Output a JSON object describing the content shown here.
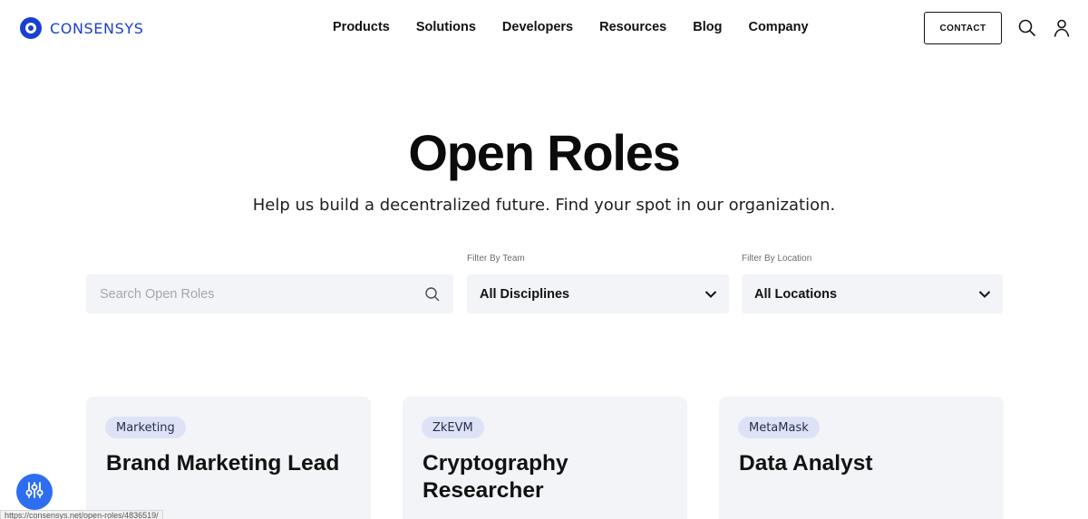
{
  "header": {
    "logo_text": "CONSENSYS",
    "nav": [
      "Products",
      "Solutions",
      "Developers",
      "Resources",
      "Blog",
      "Company"
    ],
    "contact_label": "CONTACT",
    "search_icon": "search-icon",
    "user_icon": "user-icon"
  },
  "hero": {
    "title": "Open Roles",
    "subtitle": "Help us build a decentralized future. Find your spot in our organization."
  },
  "filters": {
    "search_placeholder": "Search Open Roles",
    "team_label": "Filter By Team",
    "team_value": "All Disciplines",
    "location_label": "Filter By Location",
    "location_value": "All Locations"
  },
  "cards": [
    {
      "tag": "Marketing",
      "title": "Brand Marketing Lead"
    },
    {
      "tag": "ZkEVM",
      "title": "Cryptography Researcher"
    },
    {
      "tag": "MetaMask",
      "title": "Data Analyst"
    }
  ],
  "status_url": "https://consensys.net/open-roles/4836519/",
  "colors": {
    "brand": "#1b3fd1",
    "card_bg": "#f3f4f8",
    "tag_bg": "#dde2f7",
    "float_button": "#2d6ef0"
  }
}
